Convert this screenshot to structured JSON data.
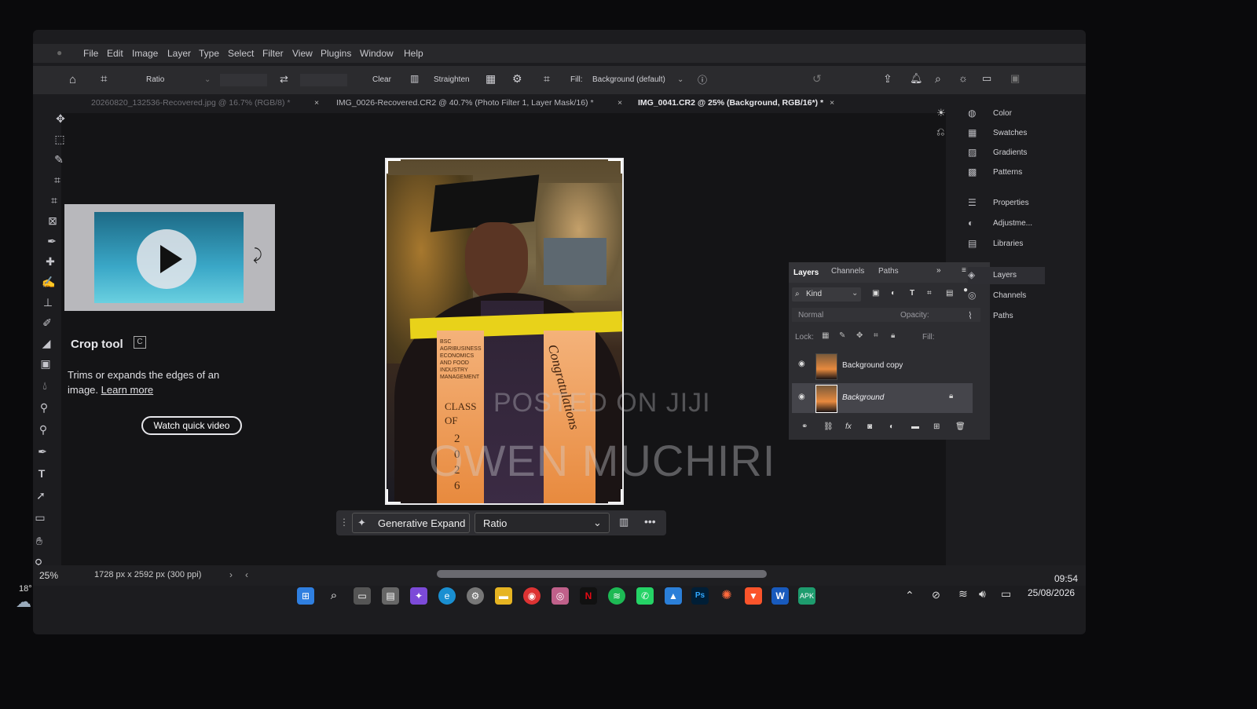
{
  "menubar": {
    "items": [
      "File",
      "Edit",
      "Image",
      "Layer",
      "Type",
      "Select",
      "Filter",
      "View",
      "Plugins",
      "Window",
      "Help"
    ]
  },
  "options_bar": {
    "ratio_label": "Ratio",
    "clear_label": "Clear",
    "straighten_label": "Straighten",
    "fill_label": "Fill:",
    "fill_value": "Background (default)"
  },
  "tabs": [
    {
      "label": "20260820_132536-Recovered.jpg @ 16.7% (RGB/8) *"
    },
    {
      "label": "IMG_0026-Recovered.CR2 @ 40.7% (Photo Filter 1, Layer Mask/16) *"
    },
    {
      "label": "IMG_0041.CR2 @ 25% (Background, RGB/16*) *"
    }
  ],
  "help_card": {
    "title": "Crop tool",
    "shortcut": "C",
    "description": "Trims or expands the edges of an image.",
    "link": "Learn more",
    "button": "Watch quick video"
  },
  "watermark": {
    "line1": "POSTED ON JIJI",
    "line2": "OWEN MUCHIRI"
  },
  "photo_sash_text": {
    "left": "BSC AGRIBUSINESS ECONOMICS AND FOOD INDUSTRY MANAGEMENT",
    "class": "CLASS OF",
    "year": "2026",
    "right": "Congratulations"
  },
  "generative_bar": {
    "button": "Generative Expand",
    "select": "Ratio"
  },
  "layers_panel": {
    "tabs": [
      "Layers",
      "Channels",
      "Paths"
    ],
    "kind_label": "Kind",
    "blend_mode": "Normal",
    "opacity_label": "Opacity:",
    "lock_label": "Lock:",
    "fill_label": "Fill:",
    "layers": [
      {
        "name": "Background copy"
      },
      {
        "name": "Background"
      }
    ]
  },
  "right_panels": {
    "group1": [
      "Color",
      "Swatches",
      "Gradients",
      "Patterns"
    ],
    "group2": [
      "Properties",
      "Adjustme...",
      "Libraries"
    ],
    "group3": [
      "Layers",
      "Channels",
      "Paths"
    ]
  },
  "status": {
    "zoom": "25%",
    "doc_info": "1728 px x 2592 px (300 ppi)"
  },
  "taskbar": {
    "weather_temp": "18°",
    "time": "09:54",
    "date": "25/08/2026"
  },
  "colors": {
    "accent_blue": "#2f7fe0",
    "sash_orange": "#f08a2c",
    "sash_yellow": "#e8d21a"
  }
}
